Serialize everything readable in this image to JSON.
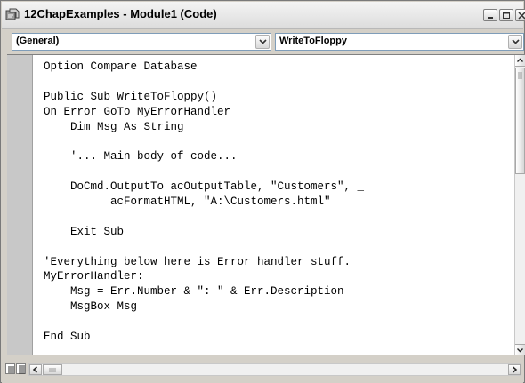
{
  "window": {
    "title": "12ChapExamples - Module1 (Code)",
    "icon": "vba-module-icon",
    "controls": [
      "minimize-icon",
      "maximize-icon",
      "close-icon"
    ]
  },
  "combos": {
    "object": {
      "value": "(General)"
    },
    "procedure": {
      "value": "WriteToFloppy"
    }
  },
  "code": {
    "lines": [
      "Option Compare Database",
      "",
      "Public Sub WriteToFloppy()",
      "On Error GoTo MyErrorHandler",
      "    Dim Msg As String",
      "",
      "    '... Main body of code...",
      "",
      "    DoCmd.OutputTo acOutputTable, \"Customers\", _",
      "          acFormatHTML, \"A:\\Customers.html\"",
      "",
      "    Exit Sub",
      "",
      "'Everything below here is Error handler stuff.",
      "MyErrorHandler:",
      "    Msg = Err.Number & \": \" & Err.Description",
      "    MsgBox Msg",
      "",
      "End Sub"
    ]
  },
  "colors": {
    "window_bg": "#d4d0c8",
    "editor_bg": "#ffffff",
    "margin_bg": "#c8c8c8",
    "text": "#000000"
  }
}
